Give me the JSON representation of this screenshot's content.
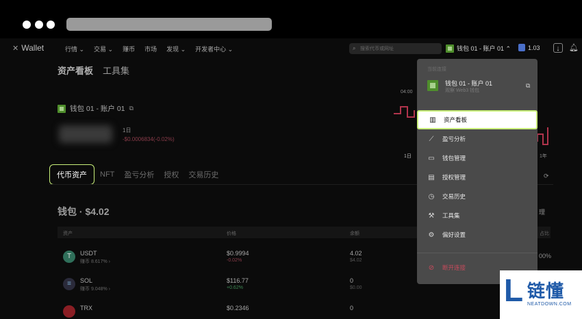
{
  "nav": {
    "logo": "Wallet",
    "links": [
      "行情 ⌄",
      "交易 ⌄",
      "赚币",
      "市场",
      "发现 ⌄",
      "开发者中心 ⌄"
    ],
    "search_placeholder": "搜索代币或网址",
    "wallet_selector": "钱包 01 - 账户 01 ⌃",
    "gas_value": "1.03"
  },
  "page": {
    "tabs": [
      "资产看板",
      "工具集"
    ],
    "account_label": "钱包 01 - 账户 01",
    "period": "1日",
    "change": "-$0.0006834(-0.02%)",
    "chart_labels": {
      "left": "04:00",
      "right_bottom": "1日",
      "far_right": "1年"
    }
  },
  "asset_tabs": [
    "代币资产",
    "NFT",
    "盈亏分析",
    "授权",
    "交易历史"
  ],
  "wallet_total": "钱包 · $4.02",
  "table": {
    "headers": {
      "asset": "资产",
      "price": "价格",
      "balance": "余额",
      "share": "占比"
    },
    "rows": [
      {
        "symbol": "USDT",
        "sub": "赚币 8.617% ›",
        "price": "$0.9994",
        "change": "-0.02%",
        "balance": "4.02",
        "usd": "$4.02",
        "share": "00%"
      },
      {
        "symbol": "SOL",
        "sub": "赚币 9.048% ›",
        "price": "$116.77",
        "change": "+0.62%",
        "balance": "0",
        "usd": "$0.00",
        "share": ""
      },
      {
        "symbol": "TRX",
        "sub": "",
        "price": "$0.2346",
        "change": "",
        "balance": "0",
        "usd": "",
        "share": ""
      }
    ],
    "manage_label": "理"
  },
  "dropdown": {
    "current_label": "当前连接",
    "account_name": "钱包 01 - 账户 01",
    "account_type": "观察 Web3 钱包",
    "items": [
      "资产看板",
      "盈亏分析",
      "钱包管理",
      "授权管理",
      "交易历史",
      "工具集",
      "偏好设置"
    ],
    "disconnect": "断开连接"
  },
  "watermark": {
    "text": "链懂",
    "sub": "NEATDOWN.COM"
  },
  "colors": {
    "accent": "#c9f07a",
    "negative": "#c94a5c",
    "positive": "#4caf6a"
  }
}
